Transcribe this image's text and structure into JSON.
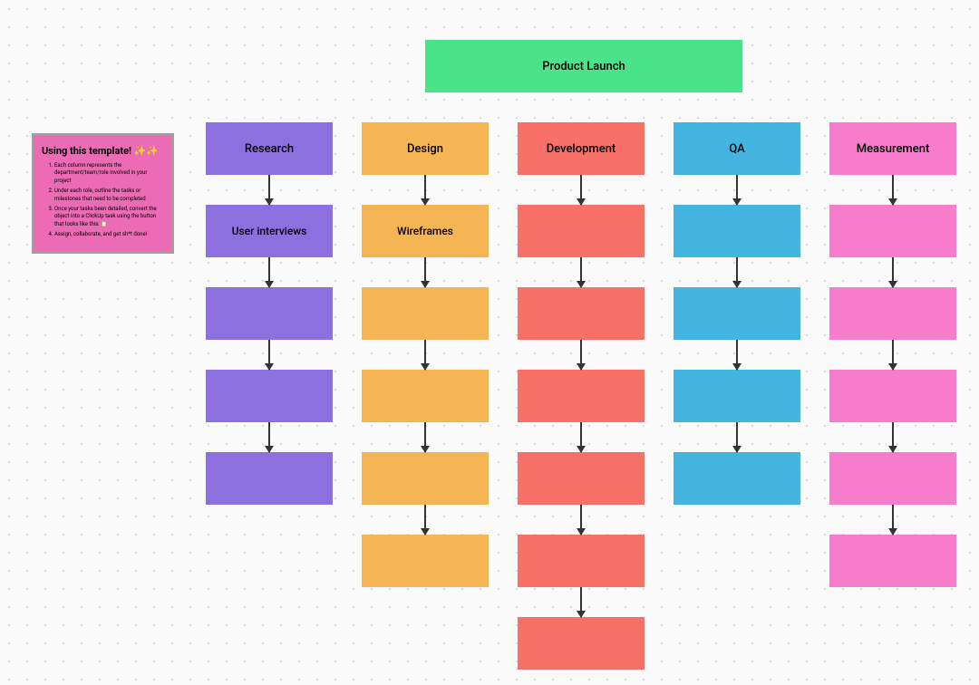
{
  "title": "Product Launch",
  "help": {
    "title": "Using this template! ✨✨",
    "items": [
      "Each column represents the department/team/role involved in your project",
      "Under each role, outline the tasks or milestones that need to be completed",
      "Once your tasks been detailed, convert the object into a ClickUp task using the button that looks like this: 📋",
      "Assign, collaborate, and get sh*t done!"
    ]
  },
  "columns": [
    {
      "color": "c-purple",
      "header": "Research",
      "boxes": [
        "User interviews",
        "",
        "",
        ""
      ]
    },
    {
      "color": "c-orange",
      "header": "Design",
      "boxes": [
        "Wireframes",
        "",
        "",
        "",
        ""
      ]
    },
    {
      "color": "c-red",
      "header": "Development",
      "boxes": [
        "",
        "",
        "",
        "",
        "",
        ""
      ]
    },
    {
      "color": "c-blue",
      "header": "QA",
      "boxes": [
        "",
        "",
        "",
        ""
      ]
    },
    {
      "color": "c-pink",
      "header": "Measurement",
      "boxes": [
        "",
        "",
        "",
        "",
        ""
      ]
    }
  ]
}
